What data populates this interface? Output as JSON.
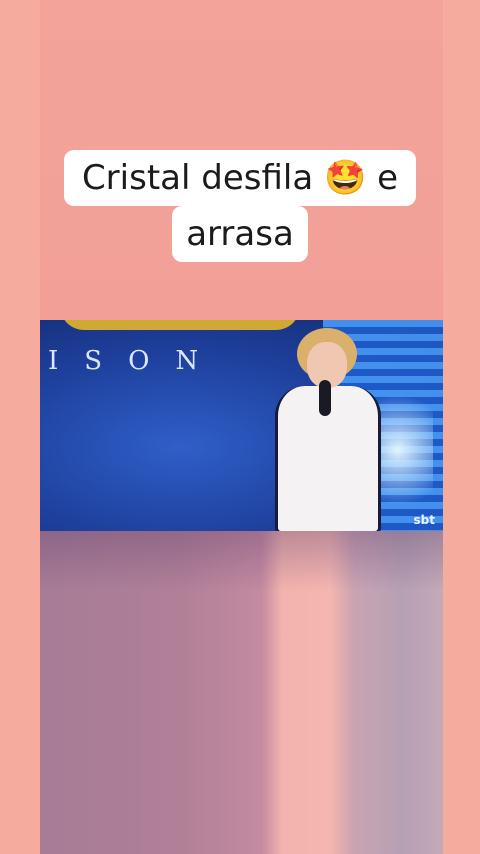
{
  "caption": {
    "line1_text": "Cristal desfila",
    "emoji": "🤩",
    "line1_end": "e",
    "line2_text": "arrasa"
  },
  "video": {
    "stage_logo_text": "ISON",
    "watermark": "sbt"
  },
  "colors": {
    "background": "#f4a89a",
    "caption_bg": "#ffffff",
    "stage_blue": "#1d3e9a"
  }
}
